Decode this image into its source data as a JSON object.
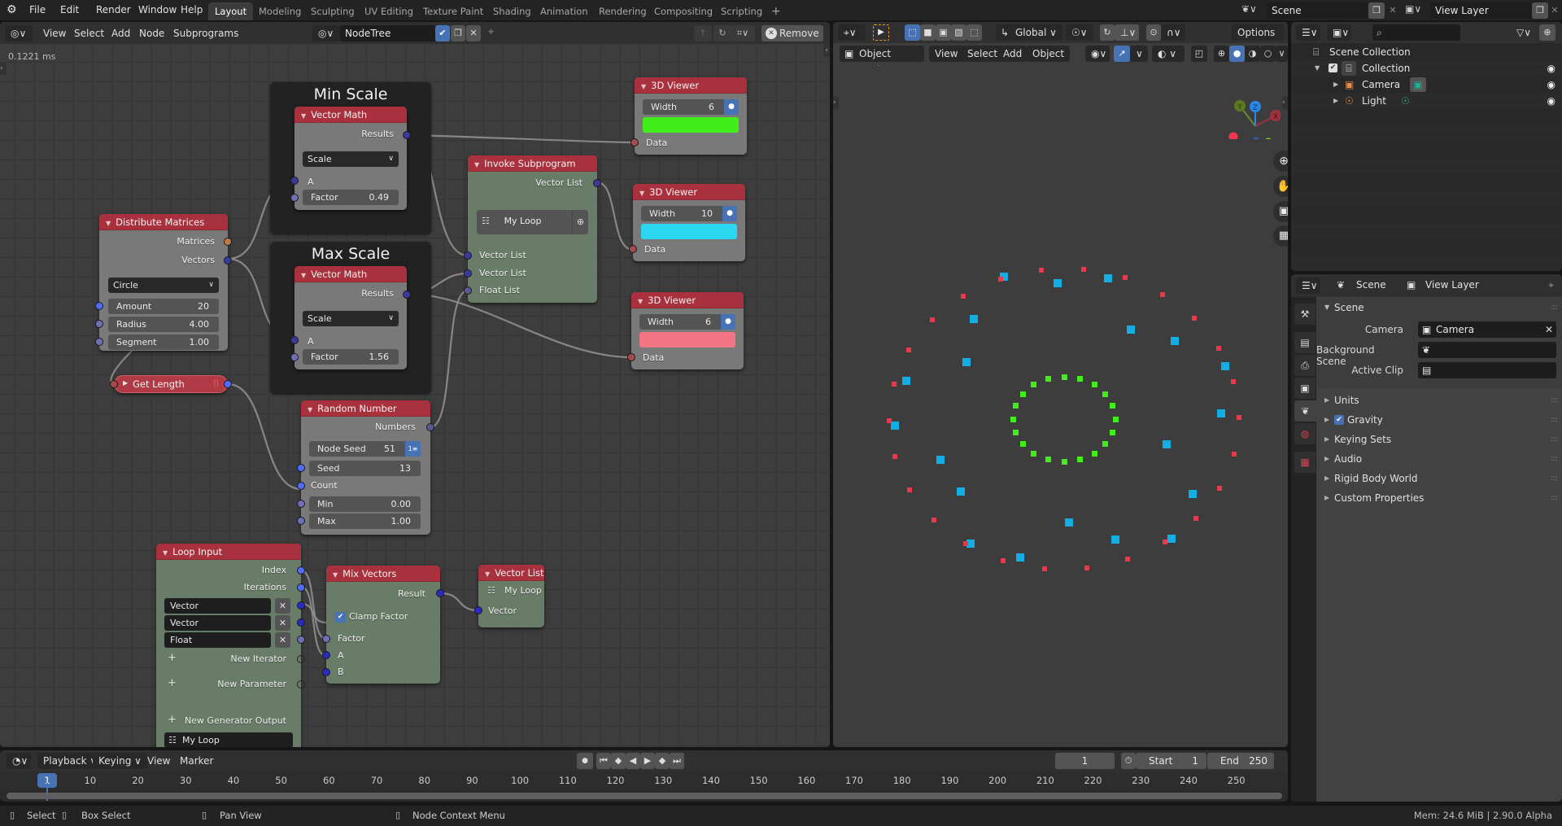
{
  "topbar": {
    "menus": [
      "File",
      "Edit",
      "Render",
      "Window",
      "Help"
    ],
    "workspaces": [
      "Layout",
      "Modeling",
      "Sculpting",
      "UV Editing",
      "Texture Paint",
      "Shading",
      "Animation",
      "Rendering",
      "Compositing",
      "Scripting"
    ],
    "active_workspace": "Layout",
    "add_workspace": "+",
    "scene": "Scene",
    "view_layer": "View Layer"
  },
  "node_editor": {
    "menus": [
      "View",
      "Select",
      "Add",
      "Node",
      "Subprograms"
    ],
    "tree_name": "NodeTree",
    "remove_label": "Remove",
    "exec_time": "0.1221 ms",
    "frames": [
      {
        "title": "Min Scale"
      },
      {
        "title": "Max Scale"
      }
    ],
    "nodes": {
      "distribute": {
        "title": "Distribute Matrices",
        "outputs": [
          "Matrices",
          "Vectors"
        ],
        "mode": "Circle",
        "fields": [
          {
            "label": "Amount",
            "value": "20"
          },
          {
            "label": "Radius",
            "value": "4.00"
          },
          {
            "label": "Segment",
            "value": "1.00"
          }
        ]
      },
      "get_length": {
        "title": "Get Length"
      },
      "vmath_min": {
        "title": "Vector Math",
        "output": "Results",
        "operation": "Scale",
        "input_a": "A",
        "factor_label": "Factor",
        "factor": "0.49"
      },
      "vmath_max": {
        "title": "Vector Math",
        "output": "Results",
        "operation": "Scale",
        "input_a": "A",
        "factor_label": "Factor",
        "factor": "1.56"
      },
      "invoke": {
        "title": "Invoke Subprogram",
        "output": "Vector List",
        "subprogram": "My Loop",
        "inputs": [
          "Vector List",
          "Vector List",
          "Float List"
        ]
      },
      "viewer1": {
        "title": "3D Viewer",
        "width_label": "Width",
        "width": "6",
        "color": "#41ee1a",
        "input": "Data"
      },
      "viewer2": {
        "title": "3D Viewer",
        "width_label": "Width",
        "width": "10",
        "color": "#2ad6f0",
        "input": "Data"
      },
      "viewer3": {
        "title": "3D Viewer",
        "width_label": "Width",
        "width": "6",
        "color": "#f17583",
        "input": "Data"
      },
      "random": {
        "title": "Random Number",
        "output": "Numbers",
        "node_seed_label": "Node Seed",
        "node_seed": "51",
        "seed_label": "Seed",
        "seed": "13",
        "count_label": "Count",
        "min_label": "Min",
        "min": "0.00",
        "max_label": "Max",
        "max": "1.00"
      },
      "loop_input": {
        "title": "Loop Input",
        "outputs": [
          "Index",
          "Iterations"
        ],
        "params": [
          "Vector",
          "Vector",
          "Float"
        ],
        "new_iterator": "New Iterator",
        "new_parameter": "New Parameter",
        "new_generator": "New Generator Output",
        "loop_name": "My Loop"
      },
      "mix": {
        "title": "Mix Vectors",
        "output": "Result",
        "clamp_label": "Clamp Factor",
        "clamp": true,
        "inputs": [
          "Factor",
          "A",
          "B"
        ]
      },
      "vector_list": {
        "title": "Vector List",
        "loop_name": "My Loop",
        "input": "Vector"
      }
    }
  },
  "viewport": {
    "tool_header": {
      "orientation": "Global",
      "options": "Options"
    },
    "mode": "Object Mode",
    "menus": [
      "View",
      "Select",
      "Add",
      "Object"
    ],
    "gizmo_axes": [
      "X",
      "Y",
      "Z"
    ]
  },
  "outliner": {
    "search_placeholder": "",
    "root": "Scene Collection",
    "items": [
      {
        "name": "Collection",
        "checked": true
      },
      {
        "name": "Camera"
      },
      {
        "name": "Light"
      }
    ]
  },
  "properties": {
    "breadcrumb": [
      "Scene",
      "View Layer"
    ],
    "section": "Scene",
    "fields": [
      {
        "label": "Camera",
        "value": "Camera"
      },
      {
        "label": "Background Scene",
        "value": ""
      },
      {
        "label": "Active Clip",
        "value": ""
      }
    ],
    "panels": [
      "Units",
      "Gravity",
      "Keying Sets",
      "Audio",
      "Rigid Body World",
      "Custom Properties"
    ],
    "gravity_enabled": true
  },
  "timeline": {
    "menus": [
      "Playback",
      "Keying",
      "View",
      "Marker"
    ],
    "current_frame": "1",
    "start_label": "Start",
    "start": "1",
    "end_label": "End",
    "end": "250",
    "ticks": [
      "10",
      "20",
      "30",
      "40",
      "50",
      "60",
      "70",
      "80",
      "90",
      "100",
      "110",
      "120",
      "130",
      "140",
      "150",
      "160",
      "170",
      "180",
      "190",
      "200",
      "210",
      "220",
      "230",
      "240",
      "250"
    ],
    "playhead": "1"
  },
  "statusbar": {
    "items": [
      "Select",
      "Box Select",
      "Pan View",
      "Node Context Menu"
    ],
    "info": "Mem: 24.6 MiB | 2.90.0 Alpha"
  }
}
